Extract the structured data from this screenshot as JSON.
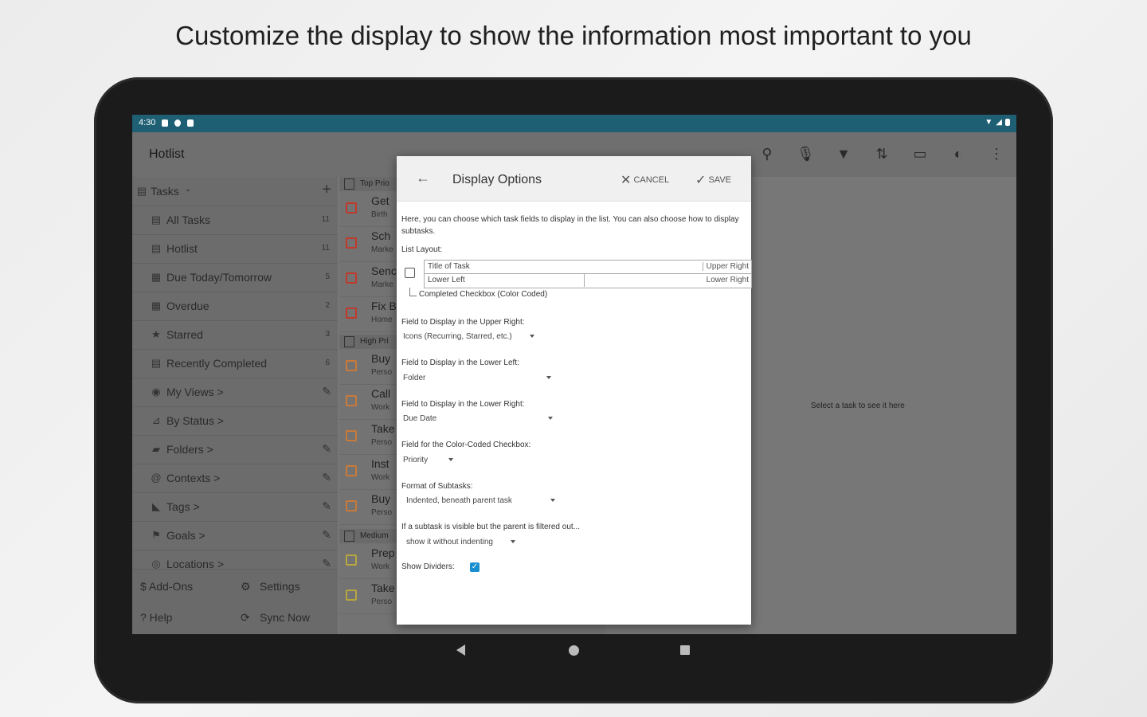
{
  "headline": "Customize the display to show the information most important to you",
  "status_bar": {
    "time": "4:30"
  },
  "app_bar": {
    "title": "Hotlist"
  },
  "sidebar": {
    "section": "Tasks",
    "items": [
      {
        "label": "All Tasks",
        "count": "11"
      },
      {
        "label": "Hotlist",
        "count": "11"
      },
      {
        "label": "Due Today/Tomorrow",
        "count": "5"
      },
      {
        "label": "Overdue",
        "count": "2"
      },
      {
        "label": "Starred",
        "count": "3"
      },
      {
        "label": "Recently Completed",
        "count": "6"
      },
      {
        "label": "My Views >"
      },
      {
        "label": "By Status >"
      },
      {
        "label": "Folders >"
      },
      {
        "label": "Contexts >"
      },
      {
        "label": "Tags >"
      },
      {
        "label": "Goals >"
      },
      {
        "label": "Locations >"
      }
    ],
    "bottom": {
      "addons": "$ Add-Ons",
      "settings": "Settings",
      "help": "? Help",
      "sync": "Sync Now"
    }
  },
  "task_list": {
    "groups": [
      "Top Prio",
      "High Pri",
      "Medium"
    ],
    "tasks": [
      {
        "title": "Get",
        "sub": "Birth"
      },
      {
        "title": "Sch",
        "sub": "Marke"
      },
      {
        "title": "Senc",
        "sub": "Marke"
      },
      {
        "title": "Fix B",
        "sub": "Home"
      },
      {
        "title": "Buy",
        "sub": "Perso"
      },
      {
        "title": "Call",
        "sub": "Work"
      },
      {
        "title": "Take",
        "sub": "Perso"
      },
      {
        "title": "Inst",
        "sub": "Work"
      },
      {
        "title": "Buy",
        "sub": "Perso"
      },
      {
        "title": "Prep",
        "sub": "Work"
      },
      {
        "title": "Take",
        "sub": "Perso"
      }
    ]
  },
  "detail_hint": "Select a task to see it here",
  "dialog": {
    "title": "Display Options",
    "cancel": "CANCEL",
    "save": "SAVE",
    "intro": "Here, you can choose which task fields to display in the list. You can also choose how to display subtasks.",
    "list_layout_label": "List Layout:",
    "layout_title": "Title of Task",
    "layout_upper_right": "Upper Right",
    "layout_lower_left": "Lower Left",
    "layout_lower_right": "Lower Right",
    "completed_checkbox": "Completed Checkbox (Color Coded)",
    "upper_right_label": "Field to Display in the Upper Right:",
    "upper_right_value": "Icons (Recurring, Starred, etc.)",
    "lower_left_label": "Field to Display in the Lower Left:",
    "lower_left_value": "Folder",
    "lower_right_label": "Field to Display in the Lower Right:",
    "lower_right_value": "Due Date",
    "color_label": "Field for the Color-Coded Checkbox:",
    "color_value": "Priority",
    "subtasks_label": "Format of Subtasks:",
    "subtasks_value": "Indented, beneath parent task",
    "filtered_label": "If a subtask is visible but the parent is filtered out...",
    "filtered_value": "show it without indenting",
    "dividers_label": "Show Dividers:"
  },
  "colors": {
    "status_bar": "#1e5f74",
    "checkbox_accent": "#1a8fcf",
    "top_priority": "#c0392b",
    "high_priority": "#c97a3a",
    "medium_priority": "#b7a640"
  }
}
